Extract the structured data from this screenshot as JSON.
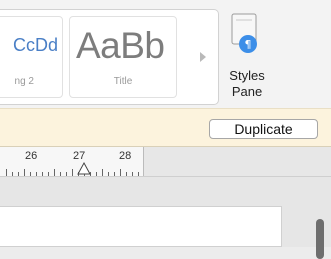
{
  "ribbon": {
    "styles": [
      {
        "sample": "CcDd",
        "name": "ng 2"
      },
      {
        "sample": "AaBb",
        "name": "Title"
      }
    ],
    "styles_pane_label": "Styles\nPane"
  },
  "infobar": {
    "duplicate_label": "Duplicate"
  },
  "ruler": {
    "labels": [
      "26",
      "27",
      "28"
    ]
  },
  "colors": {
    "heading_sample": "#4a7fc6",
    "infobar_bg": "#fcf3dd",
    "styles_pane_icon": "#3c8ee8"
  }
}
